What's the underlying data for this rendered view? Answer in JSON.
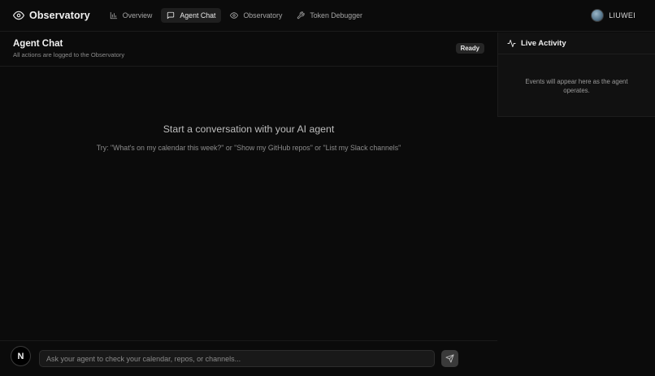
{
  "app": {
    "title": "Observatory"
  },
  "nav": {
    "items": [
      {
        "label": "Overview",
        "icon": "bar-chart-icon"
      },
      {
        "label": "Agent Chat",
        "icon": "message-square-icon",
        "active": true
      },
      {
        "label": "Observatory",
        "icon": "eye-icon"
      },
      {
        "label": "Token Debugger",
        "icon": "wrench-icon"
      }
    ]
  },
  "user": {
    "name": "LIUWEI"
  },
  "chat": {
    "title": "Agent Chat",
    "subtitle": "All actions are logged to the Observatory",
    "status": "Ready",
    "empty_title": "Start a conversation with your AI agent",
    "empty_hint": "Try: \"What's on my calendar this week?\" or \"Show my GitHub repos\" or \"List my Slack channels\""
  },
  "activity": {
    "title": "Live Activity",
    "empty": "Events will appear here as the agent operates."
  },
  "composer": {
    "badge": "N",
    "placeholder": "Ask your agent to check your calendar, repos, or channels..."
  },
  "colors": {
    "background": "#0b0b0b",
    "panel": "#111111",
    "active_nav": "#1f1f1f",
    "badge": "#262626"
  }
}
